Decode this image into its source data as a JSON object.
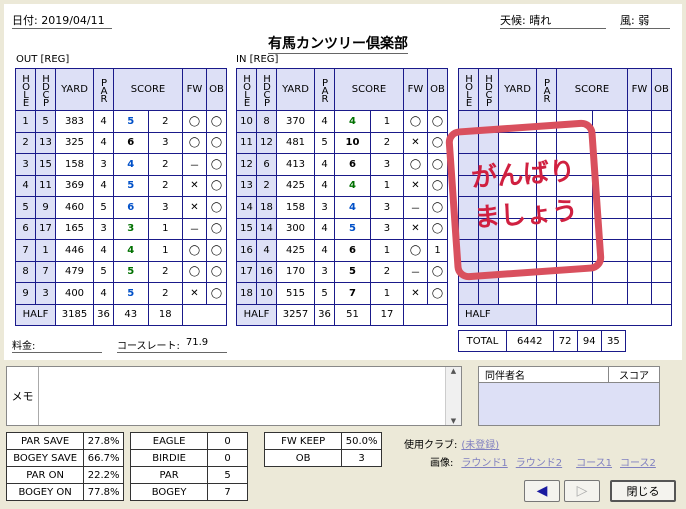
{
  "header": {
    "date": "日付: 2019/04/11",
    "weather": "天候: 晴れ",
    "wind": "風: 弱",
    "club_name": "有馬カンツリー倶楽部"
  },
  "out": {
    "label": "OUT [REG]",
    "rows": [
      [
        "1",
        "5",
        "383",
        "4",
        "5",
        "2",
        "◯",
        "◯"
      ],
      [
        "2",
        "13",
        "325",
        "4",
        "6",
        "3",
        "◯",
        "◯"
      ],
      [
        "3",
        "15",
        "158",
        "3",
        "4",
        "2",
        "－",
        "◯"
      ],
      [
        "4",
        "11",
        "369",
        "4",
        "5",
        "2",
        "✕",
        "◯"
      ],
      [
        "5",
        "9",
        "460",
        "5",
        "6",
        "3",
        "✕",
        "◯"
      ],
      [
        "6",
        "17",
        "165",
        "3",
        "3",
        "1",
        "－",
        "◯"
      ],
      [
        "7",
        "1",
        "446",
        "4",
        "4",
        "1",
        "◯",
        "◯"
      ],
      [
        "8",
        "7",
        "479",
        "5",
        "5",
        "2",
        "◯",
        "◯"
      ],
      [
        "9",
        "3",
        "400",
        "4",
        "5",
        "2",
        "✕",
        "◯"
      ]
    ],
    "half": [
      "HALF",
      "3185",
      "36",
      "43",
      "18"
    ]
  },
  "in": {
    "label": "IN [REG]",
    "rows": [
      [
        "10",
        "8",
        "370",
        "4",
        "4",
        "1",
        "◯",
        "◯"
      ],
      [
        "11",
        "12",
        "481",
        "5",
        "10",
        "2",
        "✕",
        "◯"
      ],
      [
        "12",
        "6",
        "413",
        "4",
        "6",
        "3",
        "◯",
        "◯"
      ],
      [
        "13",
        "2",
        "425",
        "4",
        "4",
        "1",
        "✕",
        "◯"
      ],
      [
        "14",
        "18",
        "158",
        "3",
        "4",
        "3",
        "－",
        "◯"
      ],
      [
        "15",
        "14",
        "300",
        "4",
        "5",
        "3",
        "✕",
        "◯"
      ],
      [
        "16",
        "4",
        "425",
        "4",
        "6",
        "1",
        "◯",
        "1"
      ],
      [
        "17",
        "16",
        "170",
        "3",
        "5",
        "2",
        "－",
        "◯"
      ],
      [
        "18",
        "10",
        "515",
        "5",
        "7",
        "1",
        "✕",
        "◯"
      ]
    ],
    "half": [
      "HALF",
      "3257",
      "36",
      "51",
      "17"
    ]
  },
  "extra": {
    "half": "HALF",
    "total": [
      "TOTAL",
      "6442",
      "72",
      "94",
      "35"
    ]
  },
  "columns": {
    "hole": "HOLE",
    "hdcp": "HDCP",
    "yard": "YARD",
    "par": "PAR",
    "score": "SCORE",
    "fw": "FW",
    "ob": "OB"
  },
  "stamp": {
    "line1": "がんばり",
    "line2": "ましょう"
  },
  "fees": {
    "fee_label": "料金:",
    "course_rate_label": "コースレート:",
    "course_rate": "71.9"
  },
  "memo": {
    "label": "メモ"
  },
  "companions": {
    "name_header": "同伴者名",
    "score_header": "スコア"
  },
  "stats1": [
    [
      "PAR SAVE",
      "27.8%"
    ],
    [
      "BOGEY SAVE",
      "66.7%"
    ],
    [
      "PAR ON",
      "22.2%"
    ],
    [
      "BOGEY ON",
      "77.8%"
    ]
  ],
  "stats2": [
    [
      "EAGLE",
      "0"
    ],
    [
      "BIRDIE",
      "0"
    ],
    [
      "PAR",
      "5"
    ],
    [
      "BOGEY",
      "7"
    ]
  ],
  "stats3": [
    [
      "FW KEEP",
      "50.0%"
    ],
    [
      "OB",
      "3"
    ]
  ],
  "clubs": {
    "label": "使用クラブ:",
    "value": "(未登録)"
  },
  "images": {
    "label": "画像:",
    "round1": "ラウンド1",
    "round2": "ラウンド2",
    "course1": "コース1",
    "course2": "コース2"
  },
  "buttons": {
    "close": "閉じる"
  },
  "colors": {
    "border": "#1a1a8a",
    "header_bg": "#dde0f6",
    "stamp": "#d9505e",
    "score_blue": "#0050c8"
  }
}
